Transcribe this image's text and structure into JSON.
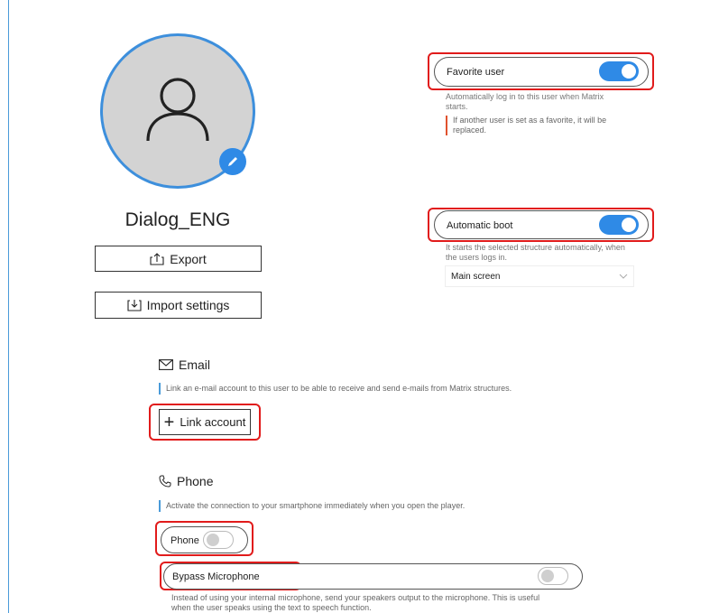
{
  "profile": {
    "name": "Dialog_ENG",
    "export_label": "Export",
    "import_label": "Import settings",
    "avatar_icon": "person-icon",
    "edit_icon": "pencil-icon"
  },
  "favorite": {
    "label": "Favorite user",
    "enabled": true,
    "description_1": "Automatically log in to this user when Matrix",
    "description_2": "starts.",
    "warning_1": "If another user is set as a favorite, it will be",
    "warning_2": "replaced."
  },
  "autoboot": {
    "label": "Automatic boot",
    "enabled": true,
    "description_1": "It starts the selected structure automatically, when",
    "description_2": "the users logs in.",
    "selected_structure": "Main screen"
  },
  "email": {
    "title": "Email",
    "description": "Link an e-mail account to this user to be able to receive and send e-mails from Matrix structures.",
    "link_label": "Link account"
  },
  "phone": {
    "title": "Phone",
    "description": "Activate the connection to your smartphone immediately when you open the player.",
    "toggle_label": "Phone",
    "enabled": false,
    "bypass_label": "Bypass Microphone",
    "bypass_enabled": false,
    "bypass_description_1": "Instead of using your internal microphone, send your speakers output to the microphone. This is useful",
    "bypass_description_2": "when the user speaks using the text to speech function."
  },
  "colors": {
    "accent": "#2f8ae6",
    "highlight": "#e11b1b",
    "warning": "#e0522e"
  }
}
